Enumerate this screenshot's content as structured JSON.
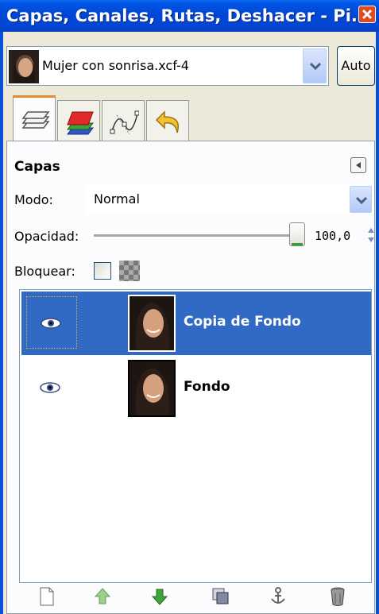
{
  "window": {
    "title": "Capas, Canales, Rutas, Deshacer - Pi..."
  },
  "image_selector": {
    "name": "Mujer con sonrisa.xcf-4",
    "auto_label": "Auto"
  },
  "tabs": [
    {
      "icon": "layers-icon"
    },
    {
      "icon": "channels-icon"
    },
    {
      "icon": "paths-icon"
    },
    {
      "icon": "undo-icon"
    }
  ],
  "panel": {
    "heading": "Capas",
    "mode_label": "Modo:",
    "mode_value": "Normal",
    "opacity_label": "Opacidad:",
    "opacity_value": "100,0",
    "opacity_fraction": 1.0,
    "lock_label": "Bloquear:"
  },
  "layers": [
    {
      "name": "Copia de Fondo",
      "visible": true,
      "selected": true
    },
    {
      "name": "Fondo",
      "visible": true,
      "selected": false
    }
  ],
  "toolbar": [
    {
      "icon": "new-layer-icon"
    },
    {
      "icon": "raise-layer-icon"
    },
    {
      "icon": "lower-layer-icon"
    },
    {
      "icon": "duplicate-layer-icon"
    },
    {
      "icon": "anchor-layer-icon"
    },
    {
      "icon": "delete-layer-icon"
    }
  ],
  "colors": {
    "titlebar": "#0047d6",
    "selection": "#316ac5",
    "active_tab": "#e68b2c"
  }
}
